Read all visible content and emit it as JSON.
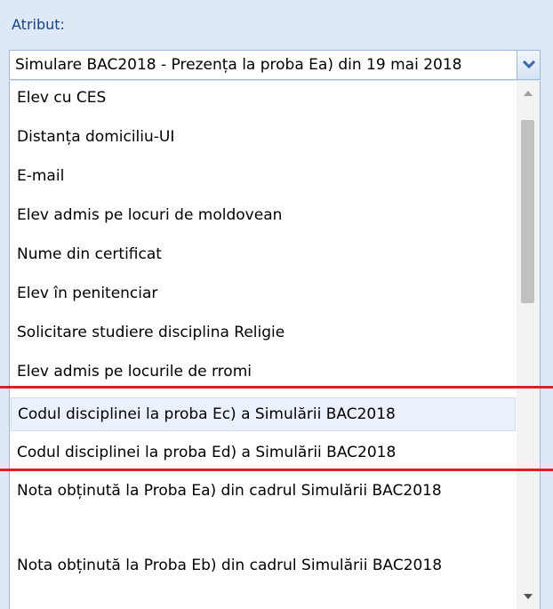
{
  "field": {
    "label": "Atribut:",
    "selected_value": "Simulare BAC2018 - Prezența la proba Ea) din 19 mai 2018"
  },
  "icons": {
    "dropdown": "chevron-down-icon",
    "scroll_up": "arrow-up-icon",
    "scroll_down": "arrow-down-icon"
  },
  "colors": {
    "panel_bg": "#dfe8f6",
    "label": "#15428b",
    "hover_row": "#eaf1fb",
    "highlight_line": "#e02020"
  },
  "options": [
    "Elev cu CES",
    "Distanța domiciliu-UI",
    "E-mail",
    "Elev admis pe locuri de moldovean",
    "Nume din certificat",
    "Elev în penitenciar",
    "Solicitare studiere disciplina Religie",
    "Elev admis pe locurile de rromi",
    "Codul disciplinei la proba Ec) a Simulării BAC2018",
    "Codul disciplinei la proba Ed) a Simulării BAC2018",
    "Nota obținută la Proba Ea) din cadrul Simulării BAC2018",
    "Nota obținută la Proba Eb) din cadrul Simulării BAC2018"
  ]
}
